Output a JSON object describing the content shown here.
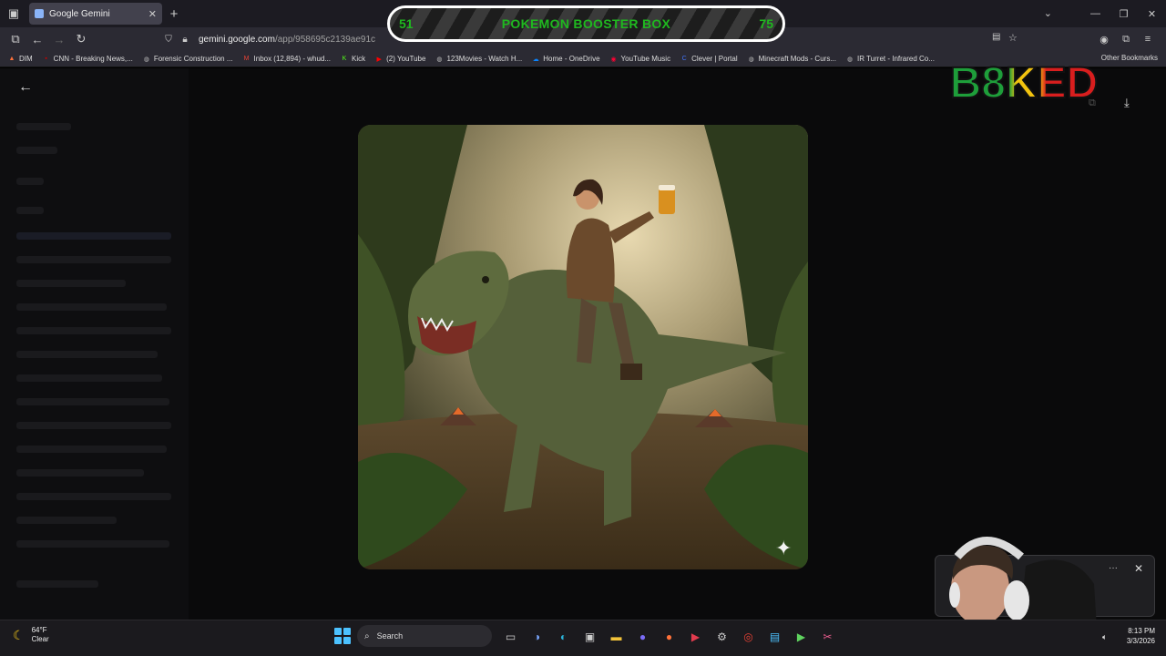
{
  "browser": {
    "tab_title": "Google Gemini",
    "url_host": "gemini.google.com",
    "url_path": "/app/958695c2139ae91c",
    "bookmarks": [
      {
        "label": "DIM",
        "icon": "fire-icon",
        "color": "#ff7139"
      },
      {
        "label": "CNN - Breaking News,...",
        "icon": "cnn-icon",
        "color": "#cc0000"
      },
      {
        "label": "Forensic Construction ...",
        "icon": "globe-icon",
        "color": "#bbbbbb"
      },
      {
        "label": "Inbox (12,894) - whud...",
        "icon": "gmail-icon",
        "color": "#ea4335"
      },
      {
        "label": "Kick",
        "icon": "kick-icon",
        "color": "#53fc18"
      },
      {
        "label": "(2) YouTube",
        "icon": "youtube-icon",
        "color": "#ff0000"
      },
      {
        "label": "123Movies - Watch H...",
        "icon": "globe-icon",
        "color": "#bbbbbb"
      },
      {
        "label": "Home - OneDrive",
        "icon": "cloud-icon",
        "color": "#0a84ff"
      },
      {
        "label": "YouTube Music",
        "icon": "ytmusic-icon",
        "color": "#ff0033"
      },
      {
        "label": "Clever | Portal",
        "icon": "clever-icon",
        "color": "#4274f6"
      },
      {
        "label": "Minecraft Mods - Curs...",
        "icon": "globe-icon",
        "color": "#bbbbbb"
      },
      {
        "label": "IR Turret - Infrared Co...",
        "icon": "globe-icon",
        "color": "#bbbbbb"
      }
    ],
    "other_bookmarks": "Other Bookmarks"
  },
  "overlay": {
    "left_number": "51",
    "title": "POKEMON BOOSTER BOX",
    "right_number": "75",
    "text_color": "#1fb81f"
  },
  "logo": {
    "text": "B8KED",
    "colors": [
      "#1e9e3a",
      "#f2c30f",
      "#d81e1e"
    ]
  },
  "taskbar": {
    "weather_temp": "64°F",
    "weather_desc": "Clear",
    "search_label": "Search",
    "time": "8:13 PM",
    "date": "3/3/2026",
    "apps": [
      "widgets-icon",
      "task-view-icon",
      "copilot-icon",
      "edge-icon",
      "store-icon",
      "file-explorer-icon",
      "discord-icon",
      "firefox-icon",
      "media-player-icon",
      "settings-icon",
      "chrome-icon",
      "photos-icon",
      "play-icon",
      "snipping-tool-icon"
    ]
  }
}
